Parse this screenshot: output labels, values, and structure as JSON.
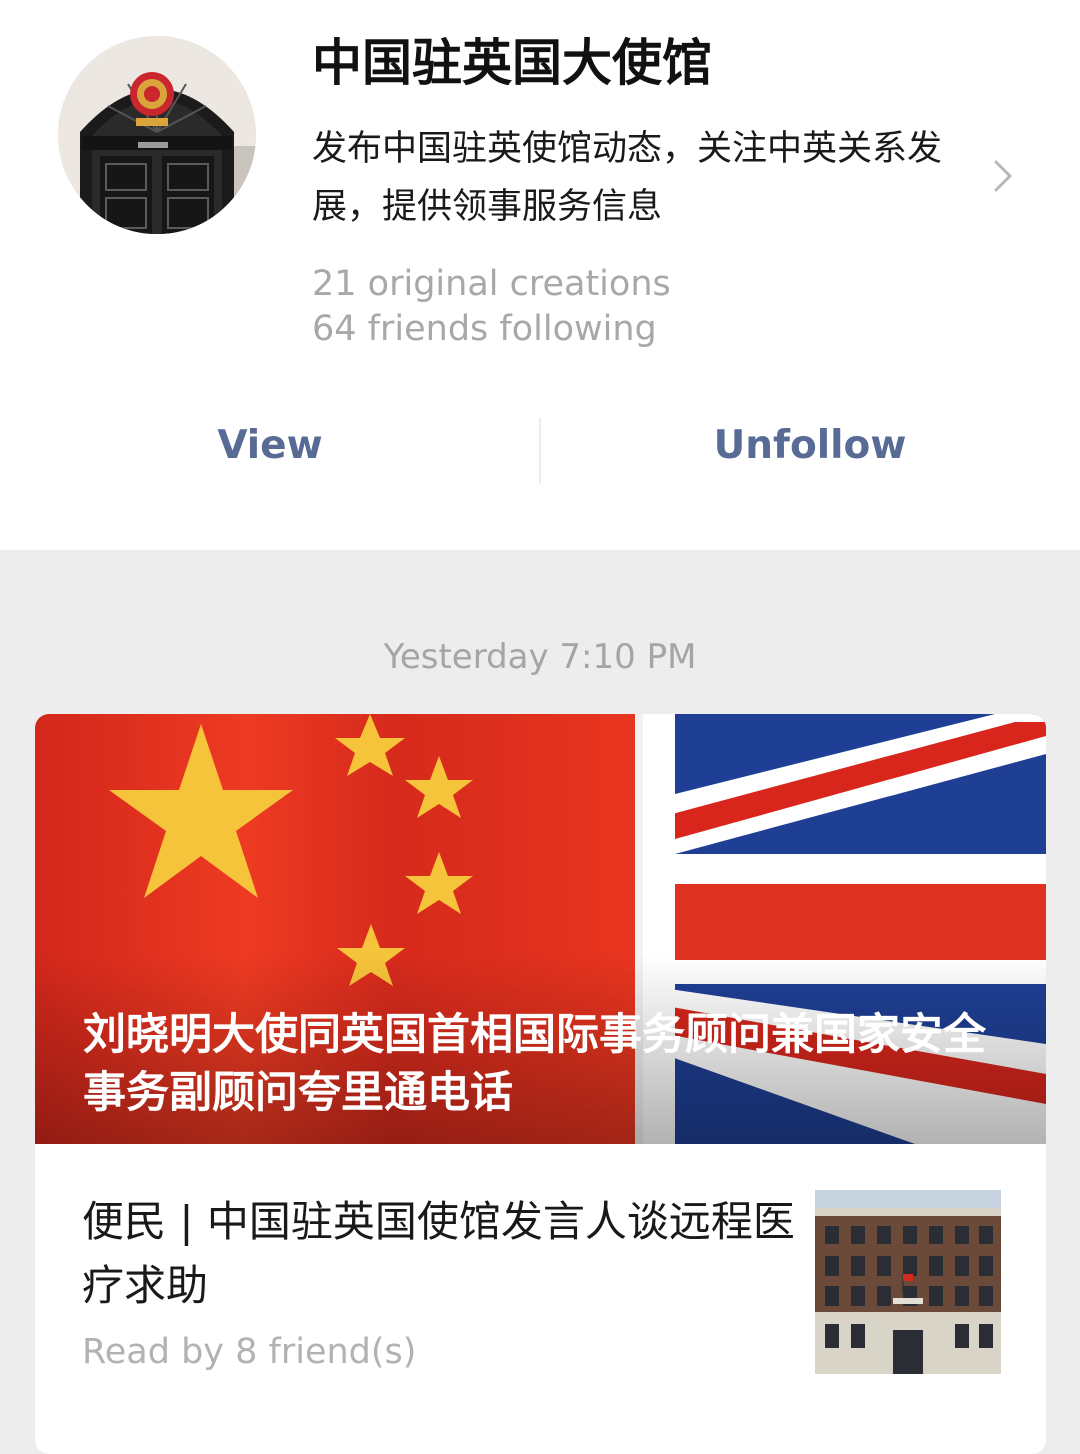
{
  "account": {
    "name": "中国驻英国大使馆",
    "description": "发布中国驻英使馆动态，关注中英关系发展，提供领事服务信息",
    "stats": {
      "original_creations": "21 original creations",
      "friends_following": "64 friends following"
    }
  },
  "actions": {
    "view_label": "View",
    "unfollow_label": "Unfollow"
  },
  "timeline": {
    "timestamp": "Yesterday 7:10 PM",
    "post": {
      "cover_title": "刘晓明大使同英国首相国际事务顾问兼国家安全事务副顾问夸里通电话",
      "article": {
        "title": "便民 | 中国驻英国使馆发言人谈远程医疗求助",
        "meta": "Read by 8 friend(s)"
      }
    }
  },
  "colors": {
    "link_blue": "#576b95",
    "muted_gray": "#a8a8a8",
    "page_background": "#ededed"
  },
  "icons": {
    "chevron": "chevron-right-icon"
  }
}
